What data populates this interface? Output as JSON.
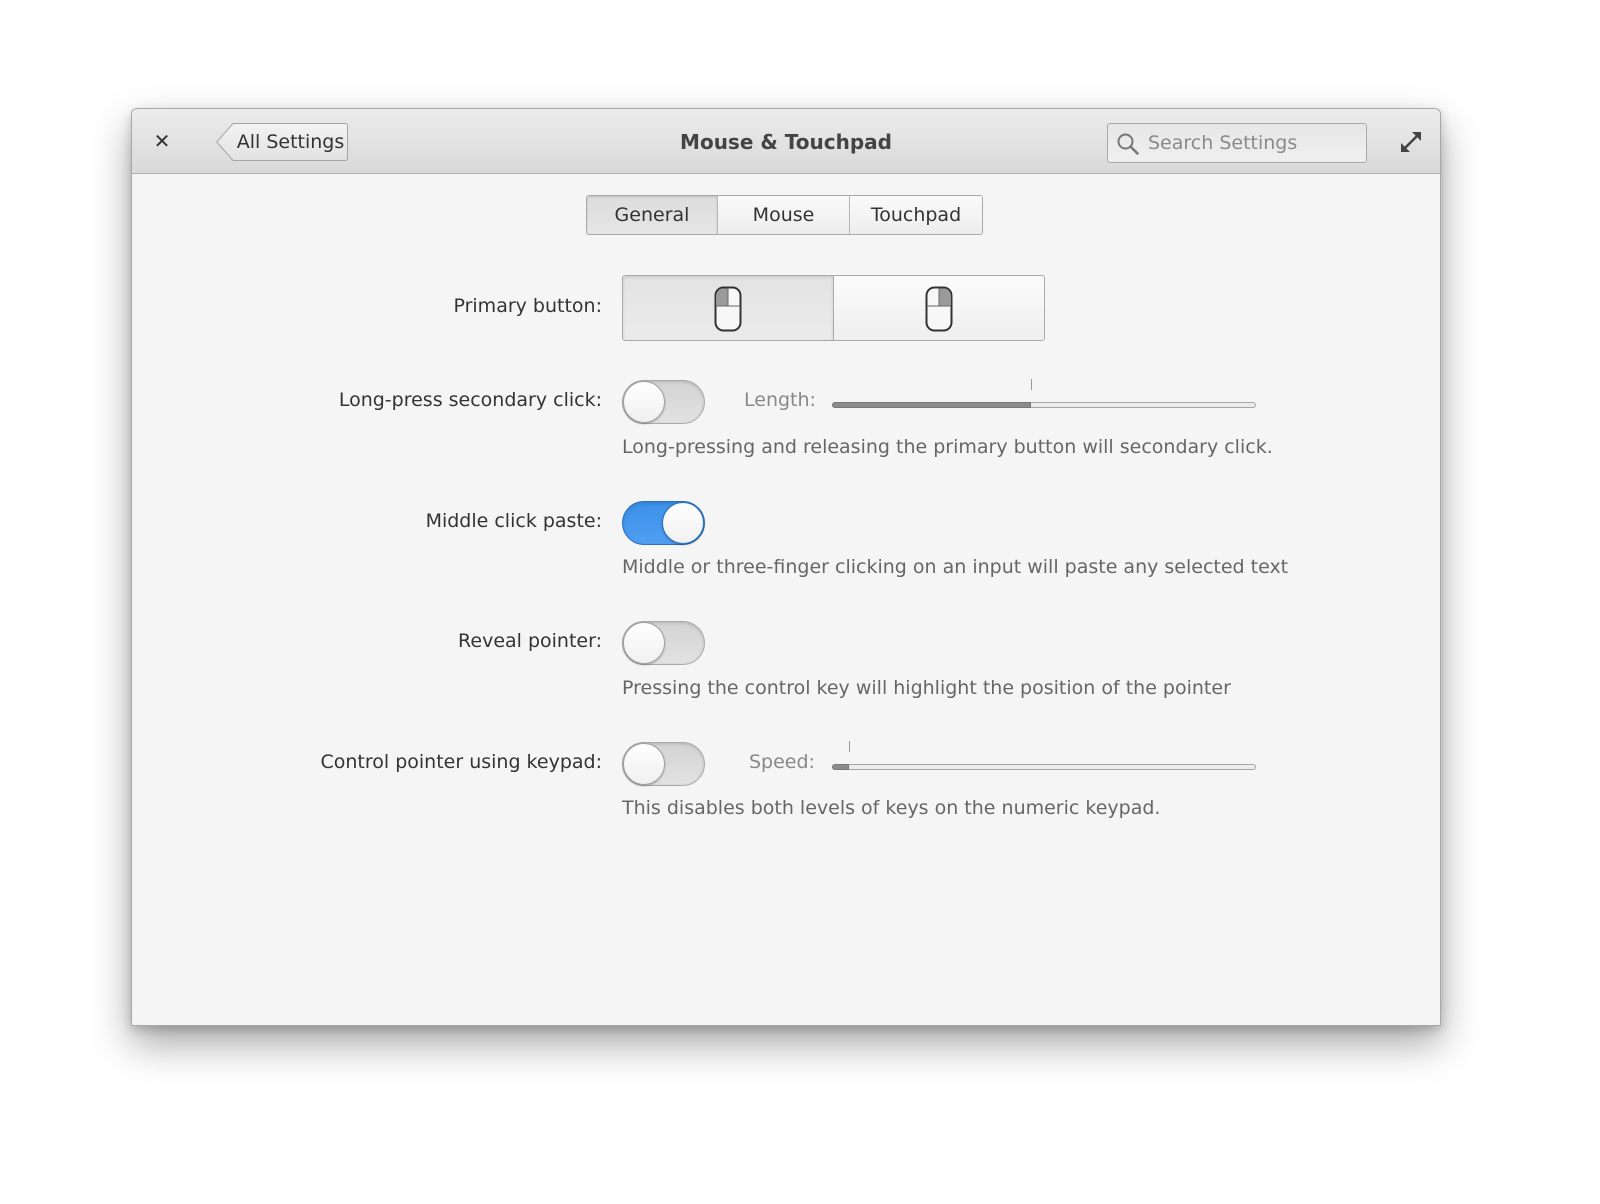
{
  "window": {
    "title": "Mouse & Touchpad",
    "back_label": "All Settings",
    "search_placeholder": "Search Settings"
  },
  "tabs": [
    {
      "label": "General",
      "active": true
    },
    {
      "label": "Mouse",
      "active": false
    },
    {
      "label": "Touchpad",
      "active": false
    }
  ],
  "general": {
    "primary_button": {
      "label": "Primary button:",
      "options": [
        "left-button-mouse-icon",
        "right-button-mouse-icon"
      ],
      "selected": "left"
    },
    "long_press": {
      "label": "Long-press secondary click:",
      "enabled": false,
      "slider_label": "Length:",
      "slider_value_fraction": 0.47,
      "description": "Long-pressing and releasing the primary button will secondary click."
    },
    "middle_click": {
      "label": "Middle click paste:",
      "enabled": true,
      "description": "Middle or three-finger clicking on an input will paste any selected text"
    },
    "reveal_pointer": {
      "label": "Reveal pointer:",
      "enabled": false,
      "description": "Pressing the control key will highlight the position of the pointer"
    },
    "keypad_pointer": {
      "label": "Control pointer using keypad:",
      "enabled": false,
      "slider_label": "Speed:",
      "slider_value_fraction": 0.04,
      "description": "This disables both levels of keys on the numeric keypad."
    }
  },
  "colors": {
    "accent": "#3d8fe8",
    "background": "#f5f5f5"
  }
}
